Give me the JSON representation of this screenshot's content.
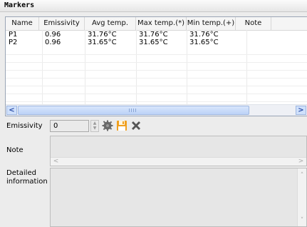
{
  "window": {
    "title": "Markers"
  },
  "table": {
    "columns": [
      "Name",
      "Emissivity",
      "Avg temp.",
      "Max temp.(*)",
      "Min temp.(+)",
      "Note"
    ],
    "rows": [
      [
        "P1",
        "0.96",
        "31.76°C",
        "31.76°C",
        "31.76°C",
        ""
      ],
      [
        "P2",
        "0.96",
        "31.65°C",
        "31.65°C",
        "31.65°C",
        ""
      ]
    ]
  },
  "scrollbar": {
    "left_glyph": "<",
    "right_glyph": ">"
  },
  "form": {
    "emissivity_label": "Emissivity",
    "emissivity_value": "0",
    "note_label": "Note",
    "detail_label_line1": "Detailed",
    "detail_label_line2": "information"
  },
  "toolbar": {
    "icons": [
      "gear-icon",
      "save-icon",
      "delete-icon"
    ],
    "colors": {
      "save": "#f0a020",
      "delete": "#555555",
      "gear": "#6a6a6a"
    }
  }
}
